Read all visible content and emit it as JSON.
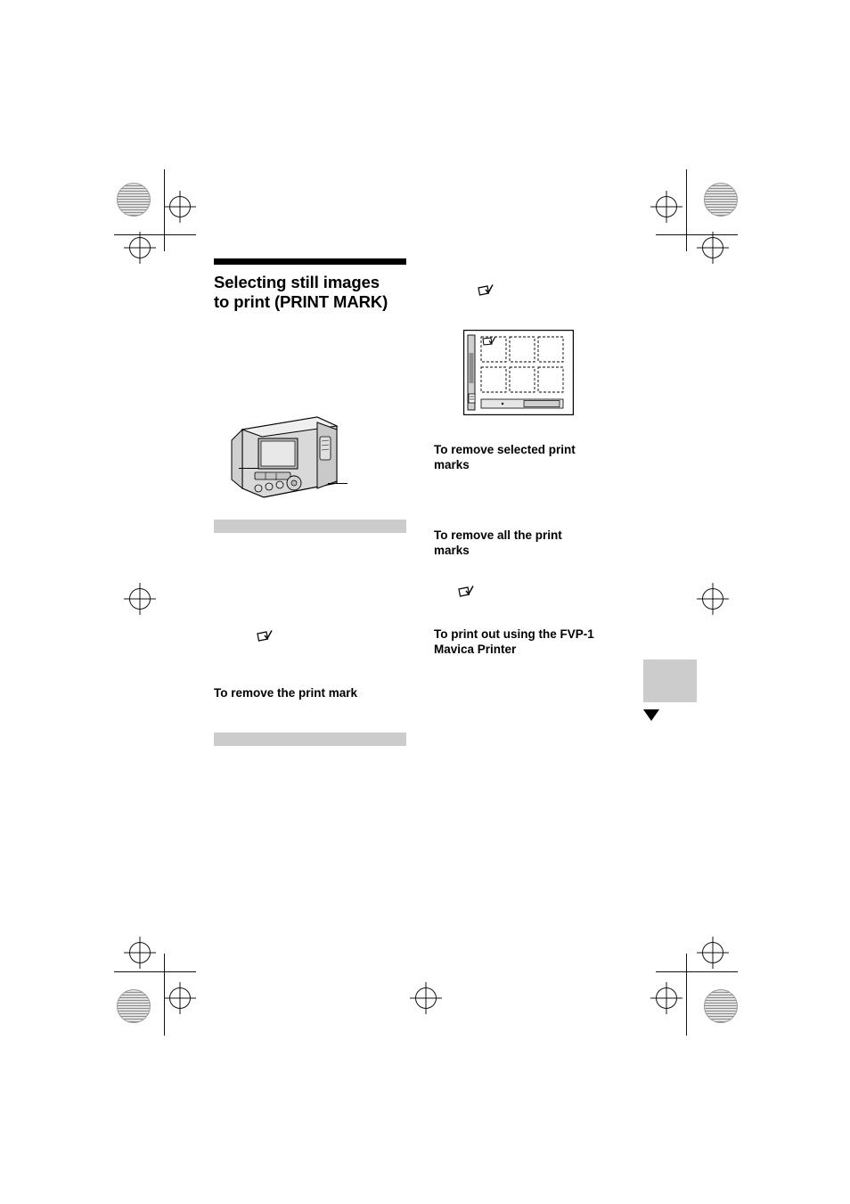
{
  "page": {
    "title_rule": "",
    "section_title_line1": "Selecting still  images",
    "section_title_line2": "to print (PRINT MARK)"
  },
  "left_column": {
    "heading_remove_print_mark": "To remove the print mark",
    "gray_bar_1": "",
    "gray_bar_2": "",
    "note_icon_name": "memo-note-icon",
    "camera_caption": ""
  },
  "right_column": {
    "note_icon_top": "",
    "lcd_caption": "",
    "heading_remove_selected_line1": "To remove selected print",
    "heading_remove_selected_line2": "marks",
    "heading_remove_all_line1": "To remove all the print",
    "heading_remove_all_line2": "marks",
    "heading_print_out_line1": "To print out using the FVP-1",
    "heading_print_out_line2": "Mavica Printer"
  },
  "page_marks": {
    "tab_label": "",
    "arrow_label": ""
  },
  "colors": {
    "gray_bar": "#cccccc",
    "rule": "#000000",
    "tab": "#cccccc"
  }
}
